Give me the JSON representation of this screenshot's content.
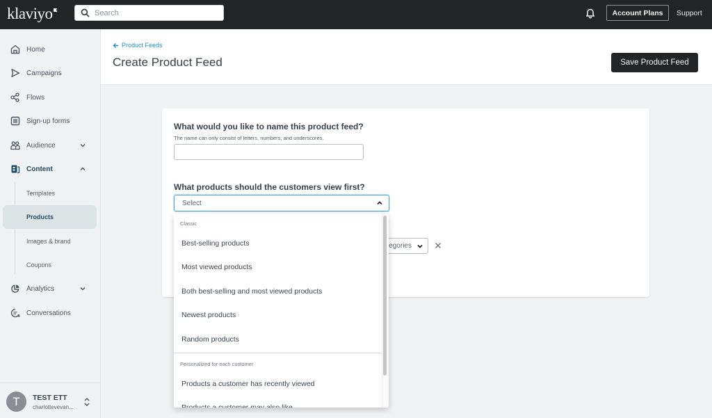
{
  "topbar": {
    "logo": "klaviyo",
    "search_placeholder": "Search",
    "account_plans": "Account Plans",
    "support": "Support"
  },
  "sidebar": {
    "items": [
      {
        "label": "Home",
        "icon": "home-icon"
      },
      {
        "label": "Campaigns",
        "icon": "send-icon"
      },
      {
        "label": "Flows",
        "icon": "flows-icon"
      },
      {
        "label": "Sign-up forms",
        "icon": "form-icon"
      },
      {
        "label": "Audience",
        "icon": "audience-icon",
        "expandable": true
      },
      {
        "label": "Content",
        "icon": "content-icon",
        "expandable": true,
        "expanded": true,
        "active": true
      }
    ],
    "subitems": [
      {
        "label": "Templates"
      },
      {
        "label": "Products",
        "active": true
      },
      {
        "label": "Images & brand"
      },
      {
        "label": "Coupons"
      }
    ],
    "bottom_items": [
      {
        "label": "Analytics",
        "icon": "analytics-icon",
        "expandable": true
      },
      {
        "label": "Conversations",
        "icon": "conversations-icon"
      }
    ],
    "user": {
      "initial": "T",
      "name": "TEST ETT",
      "email": "charlottevevan..."
    }
  },
  "header": {
    "back_link": "Product Feeds",
    "title": "Create Product Feed",
    "save_button": "Save Product Feed"
  },
  "form": {
    "name_question": "What would you like to name this product feed?",
    "name_help": "The name can only consist of letters, numbers, and underscores.",
    "name_value": "",
    "products_question": "What products should the customers view first?",
    "products_select_value": "Select",
    "category_select_partial": "egories"
  },
  "dropdown": {
    "groups": [
      {
        "label": "Classic",
        "options": [
          "Best-selling products",
          "Most viewed products",
          "Both best-selling and most viewed products",
          "Newest products",
          "Random products"
        ]
      },
      {
        "label": "Personalized for each customer",
        "options": [
          "Products a customer has recently viewed",
          "Products a customer may also like"
        ]
      }
    ]
  }
}
